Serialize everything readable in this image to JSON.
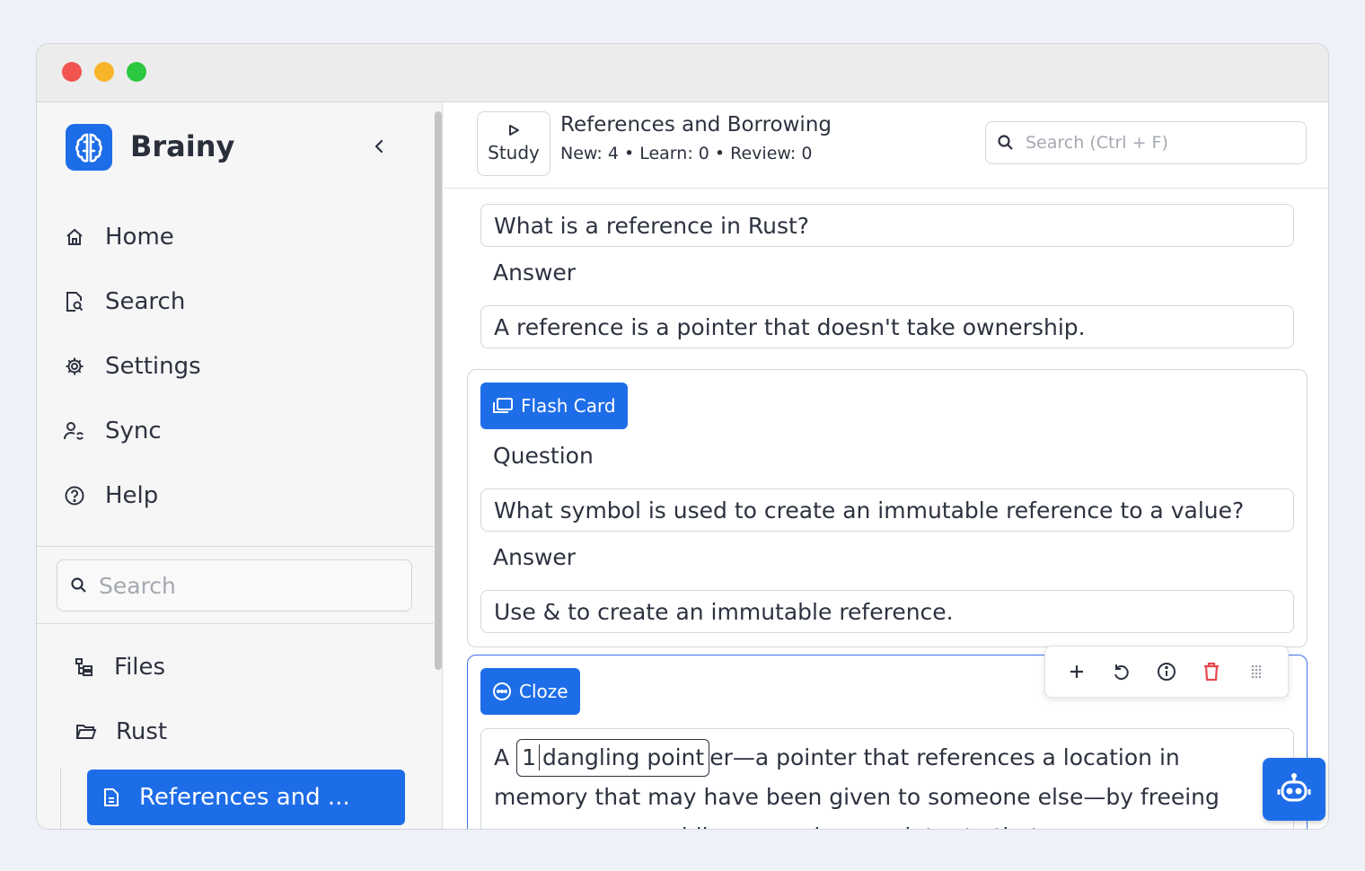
{
  "app": {
    "name": "Brainy",
    "brand_color": "#1e6de8"
  },
  "sidebar": {
    "nav": [
      {
        "label": "Home",
        "icon": "home-icon"
      },
      {
        "label": "Search",
        "icon": "search-doc-icon"
      },
      {
        "label": "Settings",
        "icon": "gear-icon"
      },
      {
        "label": "Sync",
        "icon": "sync-users-icon"
      },
      {
        "label": "Help",
        "icon": "help-circle-icon"
      }
    ],
    "search_placeholder": "Search",
    "tree": {
      "files_label": "Files",
      "folder_label": "Rust",
      "active_label": "References and ..."
    }
  },
  "topbar": {
    "study_label": "Study",
    "deck_title": "References and Borrowing",
    "deck_stats": "New: 4 • Learn: 0 • Review: 0",
    "search_placeholder": "Search (Ctrl + F)"
  },
  "content": {
    "card1": {
      "question": "What is a reference in Rust?",
      "answer_label": "Answer",
      "answer": "A reference is a pointer that doesn't take ownership."
    },
    "card2": {
      "type": "Flash Card",
      "question_label": "Question",
      "question": "What symbol is used to create an immutable reference to a value?",
      "answer_label": "Answer",
      "answer": "Use & to create an immutable reference."
    },
    "card3": {
      "type": "Cloze",
      "prefix": "A ",
      "cloze_number": "1",
      "cloze_text": "dangling point",
      "suffix": "er—a pointer that references a location in memory that may have been given to someone else—by freeing some memory while preserving a pointer to that memory."
    }
  },
  "toolbar": {
    "actions": [
      "plus-icon",
      "undo-icon",
      "info-icon",
      "trash-icon",
      "drag-handle-icon"
    ]
  }
}
